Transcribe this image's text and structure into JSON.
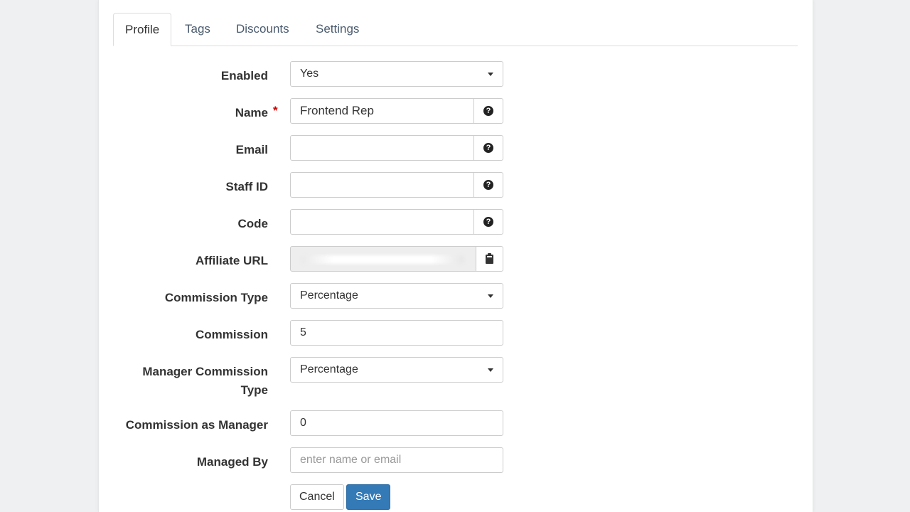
{
  "tabs": [
    {
      "label": "Profile",
      "active": true
    },
    {
      "label": "Tags",
      "active": false
    },
    {
      "label": "Discounts",
      "active": false
    },
    {
      "label": "Settings",
      "active": false
    }
  ],
  "form": {
    "enabled": {
      "label": "Enabled",
      "value": "Yes"
    },
    "name": {
      "label": "Name",
      "value": "Frontend Rep",
      "required_mark": "*",
      "help_icon": "question-circle-icon"
    },
    "email": {
      "label": "Email",
      "value": "",
      "help_icon": "question-circle-icon"
    },
    "staff_id": {
      "label": "Staff ID",
      "value": "",
      "help_icon": "question-circle-icon"
    },
    "code": {
      "label": "Code",
      "value": "",
      "help_icon": "question-circle-icon"
    },
    "affiliate_url": {
      "label": "Affiliate URL",
      "value": "",
      "copy_icon": "clipboard-icon"
    },
    "commission_type": {
      "label": "Commission Type",
      "value": "Percentage"
    },
    "commission": {
      "label": "Commission",
      "value": "5"
    },
    "manager_commission_type": {
      "label": "Manager Commission Type",
      "value": "Percentage"
    },
    "commission_as_manager": {
      "label": "Commission as Manager",
      "value": "0"
    },
    "managed_by": {
      "label": "Managed By",
      "value": "",
      "placeholder": "enter name or email"
    }
  },
  "actions": {
    "cancel_label": "Cancel",
    "save_label": "Save"
  },
  "colors": {
    "primary": "#337ab7",
    "required": "#cc0000",
    "tab_text": "#4a5b6e"
  }
}
